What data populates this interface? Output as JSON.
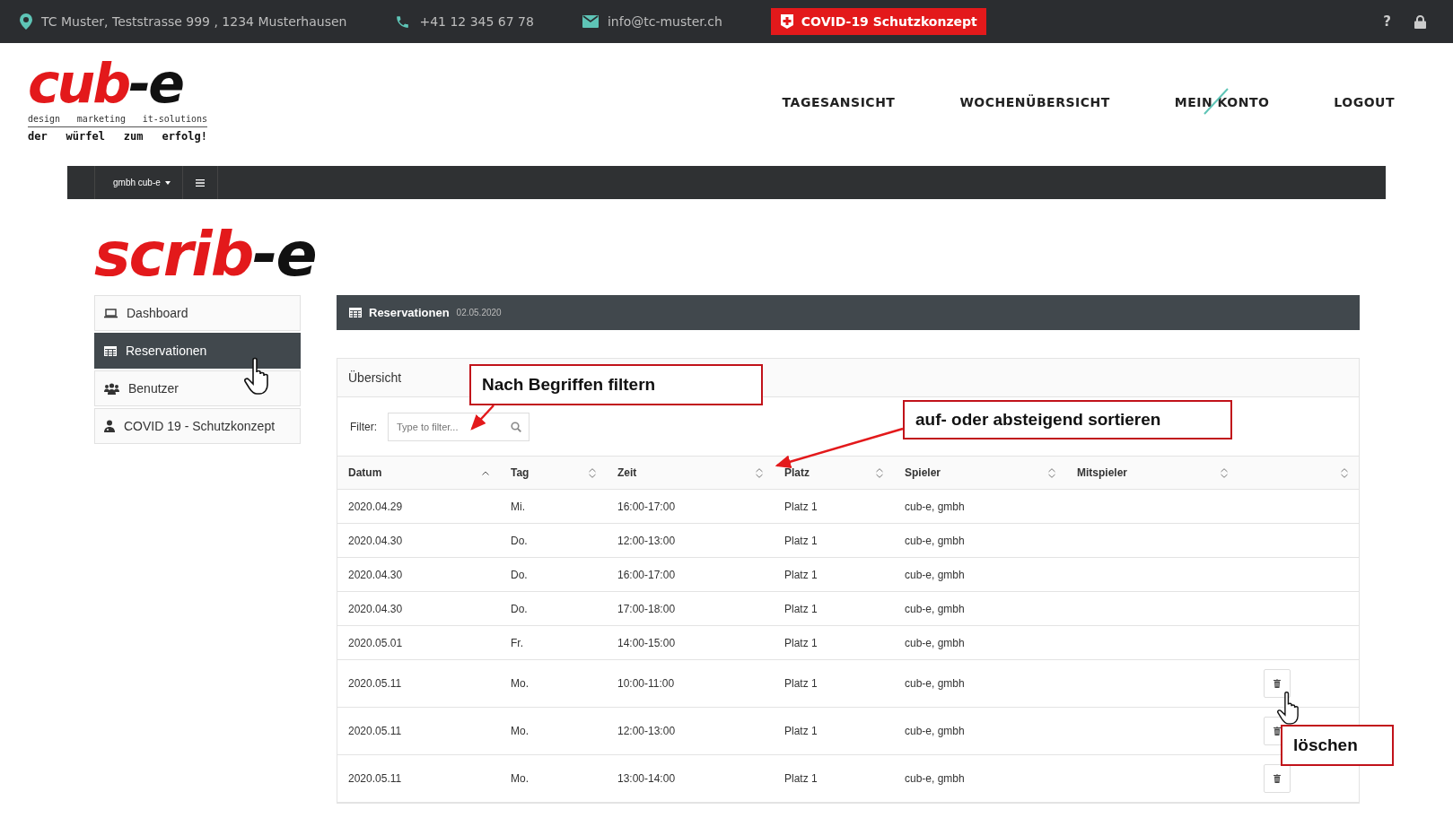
{
  "topbar": {
    "address": "TC Muster, Teststrasse 999 , 1234 Musterhausen",
    "phone": "+41 12 345 67 78",
    "email": "info@tc-muster.ch",
    "covid_button": "COVID-19 Schutzkonzept",
    "help": "?"
  },
  "header": {
    "logo": {
      "red": "cub",
      "black": "-e",
      "tagline": [
        "design",
        "marketing",
        "it-solutions"
      ],
      "slogan": [
        "der",
        "würfel",
        "zum",
        "erfolg!"
      ]
    },
    "nav": [
      {
        "label": "TAGESANSICHT"
      },
      {
        "label": "WOCHENÜBERSICHT"
      },
      {
        "label": "MEIN KONTO"
      },
      {
        "label": "LOGOUT"
      }
    ]
  },
  "subbar": {
    "account": "gmbh cub-e"
  },
  "app_logo": {
    "red": "scrib",
    "black": "-e"
  },
  "sidebar": {
    "items": [
      {
        "label": "Dashboard",
        "selected": false
      },
      {
        "label": "Reservationen",
        "selected": true
      },
      {
        "label": "Benutzer",
        "selected": false
      },
      {
        "label": "COVID 19 - Schutzkonzept",
        "selected": false
      }
    ]
  },
  "panel": {
    "title": "Reservationen",
    "date": "02.05.2020"
  },
  "card": {
    "title": "Übersicht",
    "filter_label": "Filter:",
    "filter_placeholder": "Type to filter..."
  },
  "table": {
    "columns": [
      {
        "label": "Datum",
        "sorted": true
      },
      {
        "label": "Tag",
        "sorted": false
      },
      {
        "label": "Zeit",
        "sorted": false
      },
      {
        "label": "Platz",
        "sorted": false
      },
      {
        "label": "Spieler",
        "sorted": false
      },
      {
        "label": "Mitspieler",
        "sorted": false
      },
      {
        "sorted": false
      }
    ],
    "rows": [
      {
        "cells": [
          "2020.04.29",
          "Mi.",
          "16:00-17:00",
          "Platz 1",
          "cub-e, gmbh"
        ],
        "deletable": false
      },
      {
        "cells": [
          "2020.04.30",
          "Do.",
          "12:00-13:00",
          "Platz 1",
          "cub-e, gmbh"
        ],
        "deletable": false
      },
      {
        "cells": [
          "2020.04.30",
          "Do.",
          "16:00-17:00",
          "Platz 1",
          "cub-e, gmbh"
        ],
        "deletable": false
      },
      {
        "cells": [
          "2020.04.30",
          "Do.",
          "17:00-18:00",
          "Platz 1",
          "cub-e, gmbh"
        ],
        "deletable": false
      },
      {
        "cells": [
          "2020.05.01",
          "Fr.",
          "14:00-15:00",
          "Platz 1",
          "cub-e, gmbh"
        ],
        "deletable": false
      },
      {
        "cells": [
          "2020.05.11",
          "Mo.",
          "10:00-11:00",
          "Platz 1",
          "cub-e, gmbh"
        ],
        "deletable": true
      },
      {
        "cells": [
          "2020.05.11",
          "Mo.",
          "12:00-13:00",
          "Platz 1",
          "cub-e, gmbh"
        ],
        "deletable": true
      },
      {
        "cells": [
          "2020.05.11",
          "Mo.",
          "13:00-14:00",
          "Platz 1",
          "cub-e, gmbh"
        ],
        "deletable": true
      }
    ]
  },
  "annotations": [
    {
      "kind": "filter",
      "text": "Nach Begriffen filtern"
    },
    {
      "kind": "sort",
      "text": "auf- oder absteigend sortieren"
    },
    {
      "kind": "delete",
      "text": "löschen"
    }
  ]
}
